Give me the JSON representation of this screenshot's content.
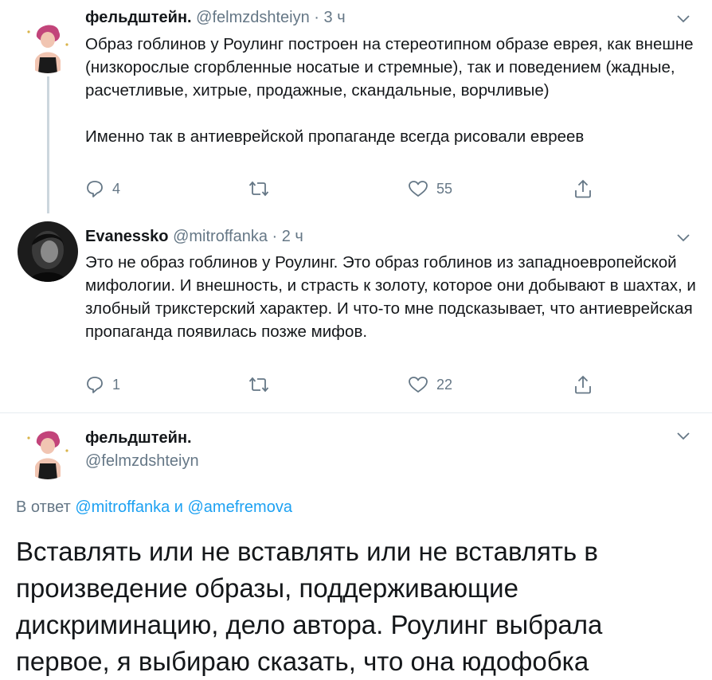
{
  "tweets": [
    {
      "author_name": "фельдштейн.",
      "author_handle": "@felmzdshteiyn",
      "time": "3 ч",
      "text": "Образ гоблинов у Роулинг построен на стереотипном образе еврея, как внешне (низкорослые сгорбленные носатые и стремные), так и поведением (жадные, расчетливые, хитрые, продажные, скандальные, ворчливые)\n\nИменно так в антиеврейской пропаганде всегда рисовали евреев",
      "replies": "4",
      "retweets": "",
      "likes": "55"
    },
    {
      "author_name": "Evanessko",
      "author_handle": "@mitroffanka",
      "time": "2 ч",
      "text": "Это не образ гоблинов у Роулинг. Это образ гоблинов из западноевропейской мифологии. И внешность, и страсть к золоту, которое они добывают в шахтах, и злобный трикстерский характер. И что-то мне подсказывает, что антиеврейская пропаганда появилась позже мифов.",
      "replies": "1",
      "retweets": "",
      "likes": "22"
    }
  ],
  "main_tweet": {
    "author_name": "фельдштейн.",
    "author_handle": "@felmzdshteiyn",
    "reply_prefix": "В ответ",
    "reply_user1": "@mitroffanka",
    "reply_and": "и",
    "reply_user2": "@amefremova",
    "text": "Вставлять или не вставлять или не вставлять в произведение образы, поддерживающие дискриминацию, дело автора. Роулинг выбрала первое, я выбираю сказать, что она юдофобка"
  },
  "icons": {
    "reply": "reply-icon",
    "retweet": "retweet-icon",
    "like": "heart-icon",
    "share": "share-icon",
    "more": "chevron-down-icon"
  },
  "colors": {
    "text": "#14171a",
    "secondary": "#657786",
    "link": "#1da1f2",
    "thread_line": "#ccd6dd"
  }
}
